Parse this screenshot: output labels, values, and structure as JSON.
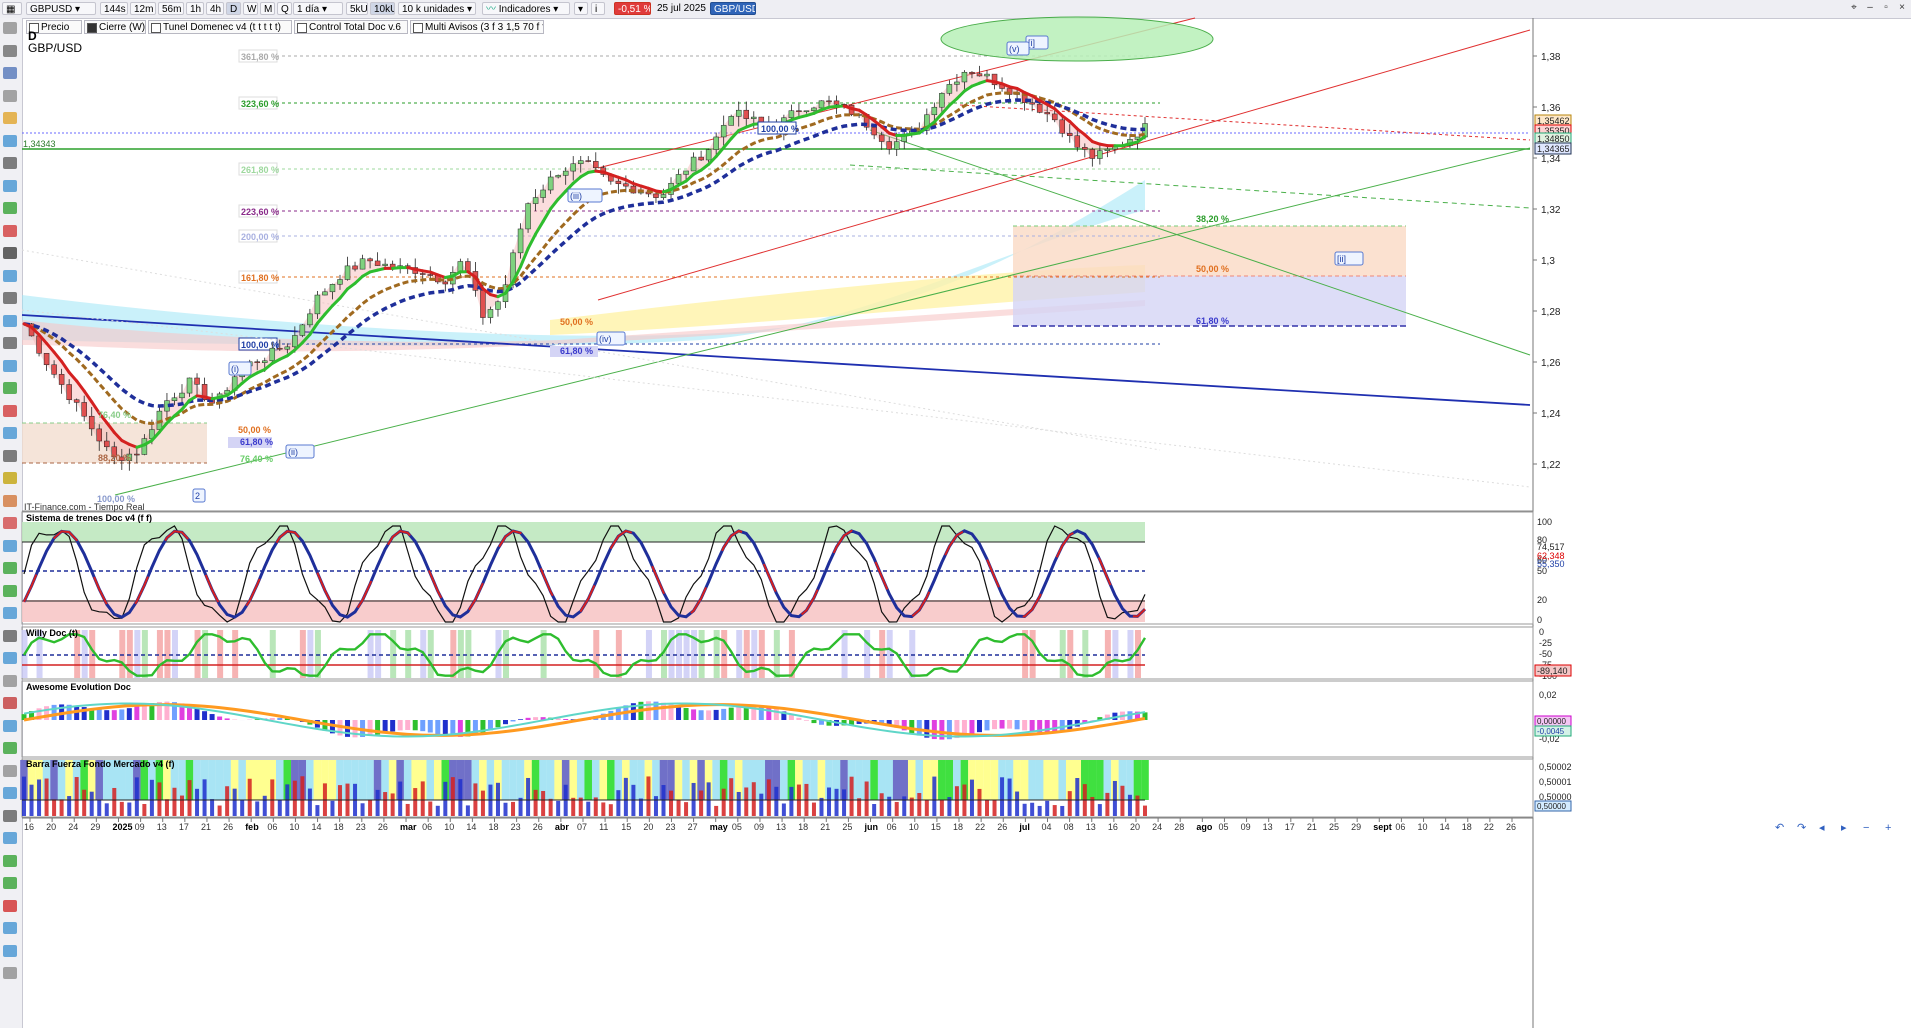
{
  "toolbar": {
    "symbol": "GBPUSD",
    "intervals": [
      "144s",
      "12m",
      "56m",
      "1h",
      "4h",
      "D",
      "W",
      "M",
      "Q"
    ],
    "selected_interval": "D",
    "period": "1 día",
    "units_a": "5kU",
    "units_b": "10kU",
    "units_select": "10 k unidades",
    "indicators_label": "Indicadores",
    "change": "-0,51 %",
    "date": "25 jul 2025",
    "pair_badge": "GBP/USD"
  },
  "subbar": [
    {
      "label": "Precio",
      "checked": false
    },
    {
      "label": "Cierre (W)",
      "checked": true
    },
    {
      "label": "Tunel Domenec v4 (t t t t t)",
      "checked": false
    },
    {
      "label": "Control Total Doc v.6",
      "checked": false
    },
    {
      "label": "Multi Avisos (3 f 3 1,5 70 f f)",
      "checked": false
    }
  ],
  "main": {
    "timeframe": "D",
    "pair": "GBP/USD",
    "source": "IT-Finance.com - Tiempo Real",
    "y_ticks": [
      "1,38",
      "1,36",
      "1,34",
      "1,32",
      "1,3",
      "1,28",
      "1,26",
      "1,24",
      "1,22"
    ],
    "price_labels": [
      "1,35462",
      "1,35350",
      "1,34850",
      "1,34365"
    ],
    "hline_label": "1,34343",
    "fib_upper": [
      "361,80 %",
      "323,60 %",
      "261,80 %",
      "223,60 %",
      "200,00 %",
      "161,80 %",
      "100,00 %"
    ],
    "fib_right": [
      "38,20 %",
      "50,00 %",
      "61,80 %"
    ],
    "fib_mid": [
      "50,00 %",
      "61,80 %"
    ],
    "fib_left": [
      "76,40 %",
      "88,20 %",
      "100,00 %",
      "50,00 %",
      "61,80 %",
      "76,40 %"
    ],
    "fib_channel": "100,00 %",
    "waves": [
      "[i]",
      "(v)",
      "[ii]",
      "(iii)",
      "(iv)",
      "(i)",
      "(ii)",
      "2"
    ]
  },
  "panels": [
    {
      "title": "Sistema de trenes Doc v4 (f f)",
      "ticks": [
        "100",
        "80",
        "60",
        "50",
        "20",
        "0"
      ],
      "labels": [
        "74,517",
        "62,348",
        "55,350"
      ]
    },
    {
      "title": "Willy Doc (t)",
      "ticks": [
        "0",
        "-25",
        "-50",
        "-75",
        "-100"
      ],
      "labels": [
        "-89,140"
      ]
    },
    {
      "title": "Awesome Evolution Doc",
      "ticks": [
        "0,02",
        "-0,02"
      ],
      "labels": [
        "0,00000",
        "-0,0045"
      ]
    },
    {
      "title": "Barra Fuerza Fondo Mercado v4 (f)",
      "ticks": [
        "0,50002",
        "0,50001",
        "0,50000"
      ],
      "labels": [
        "0,50000"
      ]
    }
  ],
  "x_axis": [
    "16",
    "20",
    "24",
    "29",
    "2025",
    "09",
    "13",
    "17",
    "21",
    "26",
    "feb",
    "06",
    "10",
    "14",
    "18",
    "23",
    "26",
    "mar",
    "06",
    "10",
    "14",
    "18",
    "23",
    "26",
    "abr",
    "07",
    "11",
    "15",
    "20",
    "23",
    "27",
    "may",
    "05",
    "09",
    "13",
    "18",
    "21",
    "25",
    "jun",
    "06",
    "10",
    "15",
    "18",
    "22",
    "26",
    "jul",
    "04",
    "08",
    "13",
    "16",
    "20",
    "24",
    "28",
    "ago",
    "05",
    "09",
    "13",
    "17",
    "21",
    "25",
    "29",
    "sept",
    "06",
    "10",
    "14",
    "18",
    "22",
    "26"
  ],
  "colors": {
    "bg": "#ffffff",
    "up": "#2ca02c",
    "down": "#d62728",
    "blue": "#1f3fa6",
    "green": "#2ebd2e",
    "red": "#e02020"
  }
}
